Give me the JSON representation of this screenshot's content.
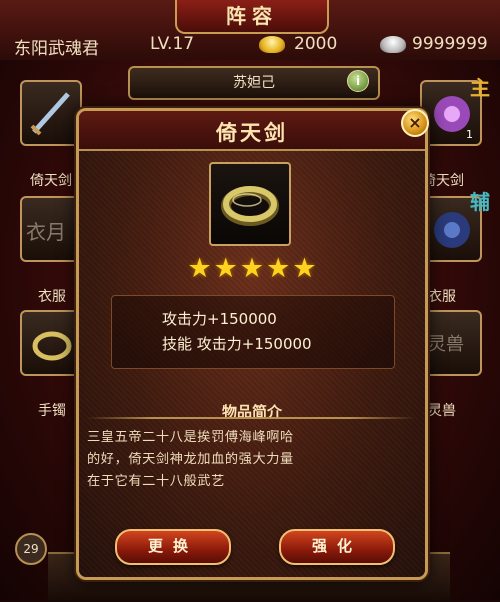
{
  "screen": {
    "title": "阵容",
    "player_name": "东阳武魂君",
    "level": "LV.17",
    "gold": "2000",
    "silver": "9999999",
    "hero_name": "苏妲己",
    "info_badge": "i",
    "side_main": "主",
    "side_assist": "辅",
    "hero_level": "29",
    "left_slots": [
      "倚天剑",
      "衣服",
      "手镯"
    ],
    "left_slot_2_icon_text": "衣月",
    "right_slots": [
      "倚天剑",
      "衣服",
      "灵兽"
    ],
    "right_slot_3_icon_text": "灵兽",
    "right_slot_1_badge": "1"
  },
  "modal": {
    "title": "倚天剑",
    "close_label": "×",
    "item_icon": "bangle-ring-icon",
    "stars": 5,
    "stats": [
      "攻击力+150000",
      "技能 攻击力+150000"
    ],
    "description_title": "物品简介",
    "description_lines": [
      "三皇五帝二十八是挨罚傅海峰啊哈",
      "的好，倚天剑神龙加血的强大力量",
      "在于它有二十八般武艺"
    ],
    "buttons": {
      "replace": "更换",
      "enhance": "强化"
    }
  },
  "colors": {
    "frame_gold": "#c79a55",
    "star": "#ffd21f",
    "button_red": "#d2451f"
  }
}
